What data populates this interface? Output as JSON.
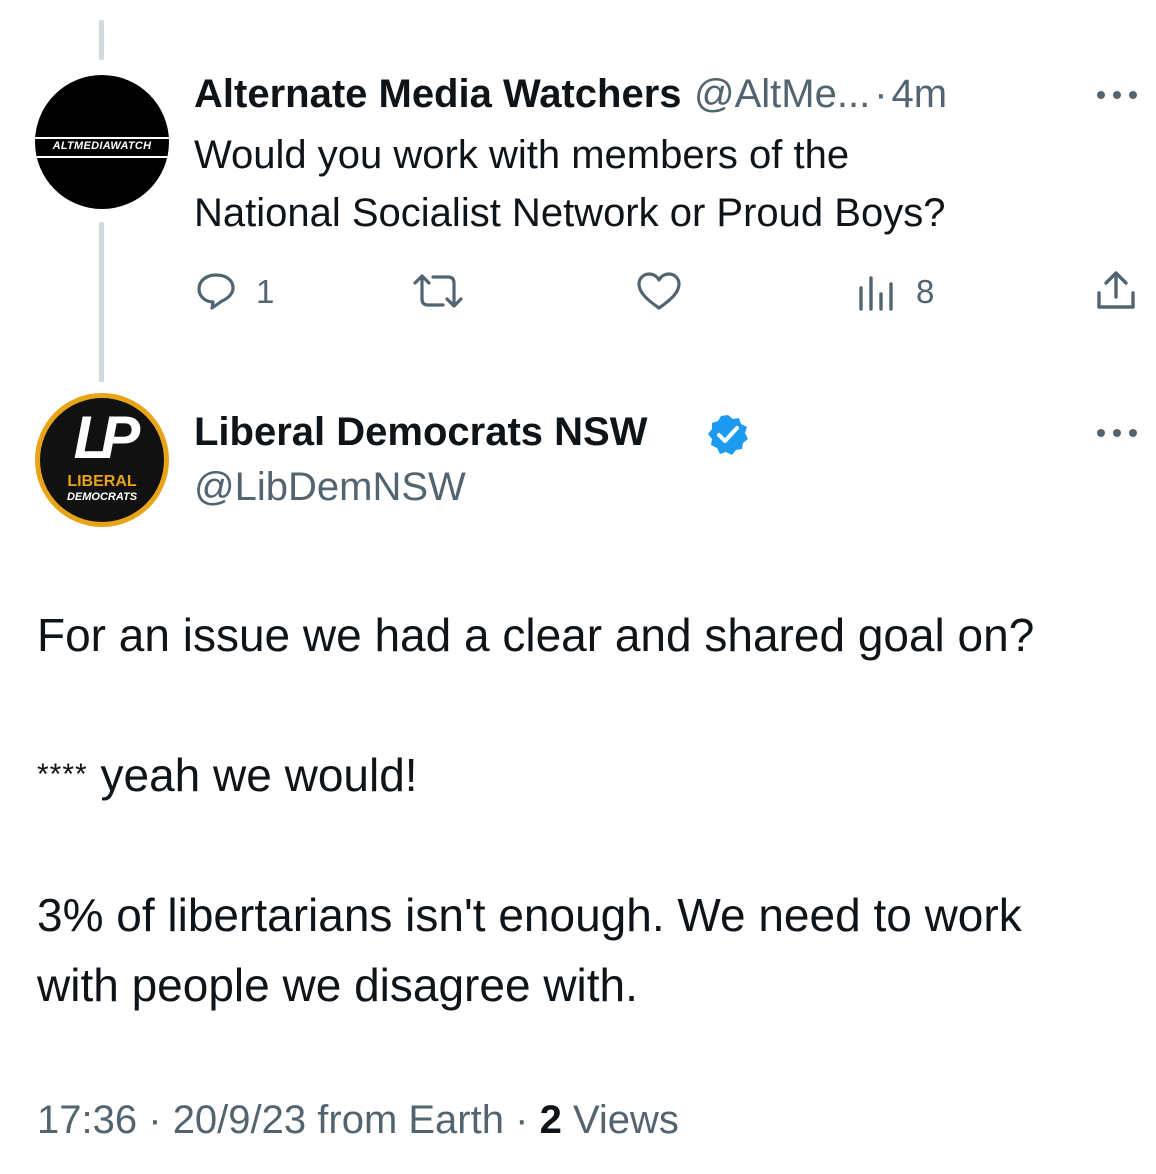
{
  "reply_to": {
    "avatar_text": "ALTMEDIAWATCH",
    "name": "Alternate Media Watchers",
    "handle": "@AltMe...",
    "separator": "·",
    "time": "4m",
    "text_line1": "Would you work with members of the",
    "text_line2": "National Socialist Network or Proud Boys?",
    "actions": {
      "reply_count": "1",
      "views_count": "8"
    },
    "icons": [
      "reply-icon",
      "retweet-icon",
      "like-icon",
      "analytics-icon",
      "share-icon",
      "more-icon"
    ]
  },
  "main_tweet": {
    "avatar_text_top": "LP",
    "avatar_text_1": "LIBERAL",
    "avatar_text_2": "DEMOCRATS",
    "name": "Liberal Democrats NSW",
    "verified": true,
    "handle": "@LibDemNSW",
    "paragraph1": "For an issue we had a clear and shared goal on?",
    "paragraph2_prefix": "****",
    "paragraph2_text": "yeah we would!",
    "paragraph3_line1": "3% of libertarians isn't enough. We need to work",
    "paragraph3_line2": "with people we disagree with.",
    "time": "17:36",
    "date": "20/9/23 from Earth",
    "dot": "·",
    "views_count": "2",
    "views_label": "Views"
  },
  "colors": {
    "text": "#0f1419",
    "muted": "#536471",
    "verified": "#1d9bf0",
    "thread_line": "#cfd9de",
    "logo_gold": "#e8a317"
  }
}
